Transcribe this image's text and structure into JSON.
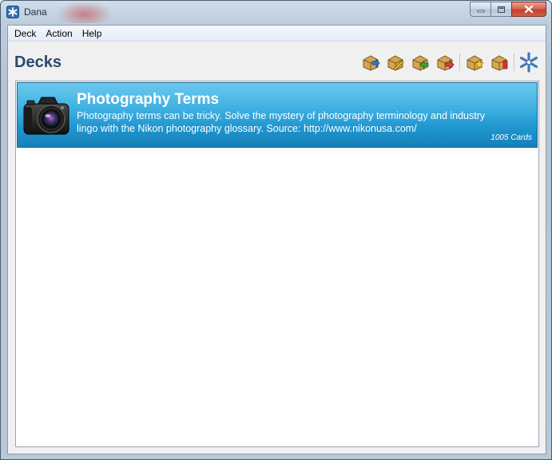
{
  "window": {
    "title": "Dana",
    "icon": "asterisk-app-icon",
    "controls": [
      "minimize-icon",
      "maximize-icon",
      "close-icon"
    ]
  },
  "menu": {
    "items": [
      {
        "label": "Deck"
      },
      {
        "label": "Action"
      },
      {
        "label": "Help"
      }
    ]
  },
  "header": {
    "title": "Decks"
  },
  "toolbar": {
    "buttons": [
      {
        "icon": "deck-import-icon"
      },
      {
        "icon": "deck-edit-icon"
      },
      {
        "icon": "deck-add-icon"
      },
      {
        "icon": "deck-remove-icon"
      },
      {
        "icon": "deck-new-icon"
      },
      {
        "icon": "deck-delete-icon"
      },
      {
        "icon": "asterisk-icon"
      }
    ]
  },
  "decks": [
    {
      "title": "Photography Terms",
      "description": "Photography terms can be tricky. Solve the mystery of photography terminology and industry lingo with the Nikon photography glossary. Source: http://www.nikonusa.com/",
      "count": "1005 Cards",
      "image": "camera-icon"
    }
  ],
  "colors": {
    "accent": "#2a4a6e",
    "selection_top": "#6cc9ee",
    "selection_bottom": "#1780b8"
  }
}
